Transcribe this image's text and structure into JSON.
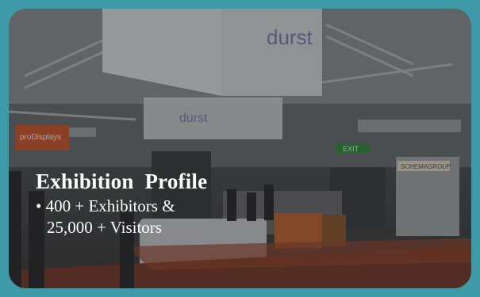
{
  "slide": {
    "background_color": "#3e9aa6",
    "title": "Exhibition  Profile",
    "bullet_marker": "•",
    "bullet_line1": "400 + Exhibitors &",
    "bullet_line2": "25,000 + Visitors"
  },
  "photo": {
    "sign_brand": "durst",
    "sign_left": "proDisplays",
    "sign_right": "SCHEMAGROUP",
    "exit_sign": "EXIT"
  }
}
